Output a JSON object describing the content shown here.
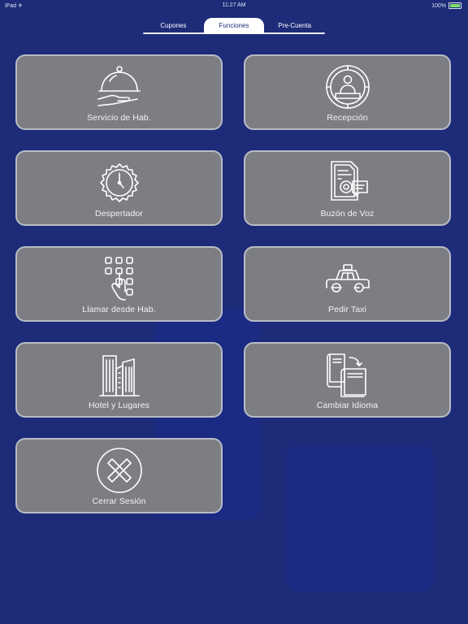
{
  "status_bar": {
    "left": "iPad ✈",
    "time": "11:27 AM",
    "battery": "100%"
  },
  "tabs": [
    {
      "label": "Cupones",
      "active": false
    },
    {
      "label": "Funciones",
      "active": true
    },
    {
      "label": "Pre-Cuenta",
      "active": false
    }
  ],
  "functions": [
    {
      "label": "Servicio de Hab.",
      "icon": "room-service-icon"
    },
    {
      "label": "Recepción",
      "icon": "reception-icon"
    },
    {
      "label": "Despertador",
      "icon": "alarm-clock-icon"
    },
    {
      "label": "Buzón de Voz",
      "icon": "voicemail-icon"
    },
    {
      "label": "Llamar desde Hab.",
      "icon": "dial-keypad-icon"
    },
    {
      "label": "Pedir Taxi",
      "icon": "taxi-icon"
    },
    {
      "label": "Hotel y Lugares",
      "icon": "buildings-icon"
    },
    {
      "label": "Cambiar Idioma",
      "icon": "language-books-icon"
    },
    {
      "label": "Cerrar Sesión",
      "icon": "logout-x-icon"
    }
  ],
  "colors": {
    "background": "#1d2b78",
    "card": "#7d7e84",
    "card_border": "#b9bcc6"
  }
}
